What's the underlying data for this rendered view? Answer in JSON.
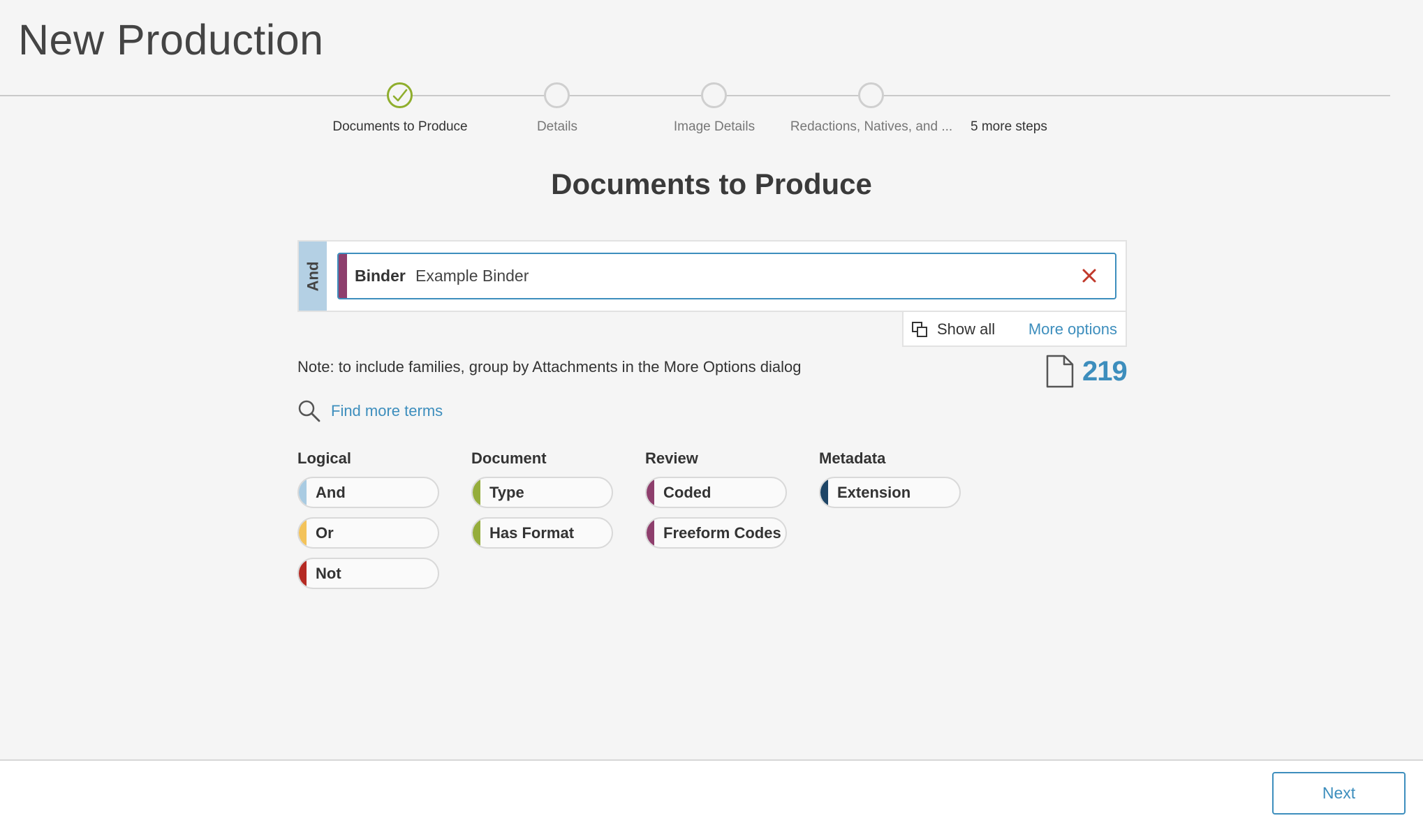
{
  "page": {
    "title": "New Production"
  },
  "stepper": {
    "steps": [
      {
        "label": "Documents to Produce",
        "state": "done",
        "icon": "check-icon"
      },
      {
        "label": "Details",
        "state": "pending"
      },
      {
        "label": "Image Details",
        "state": "pending"
      },
      {
        "label": "Redactions, Natives, and ...",
        "state": "pending"
      }
    ],
    "more_steps": "5 more steps"
  },
  "section": {
    "title": "Documents to Produce"
  },
  "query": {
    "operator": "And",
    "term": {
      "field": "Binder",
      "value": "Example Binder",
      "color": "#8e3f6d",
      "remove_icon": "close-icon"
    },
    "show_all": "Show all",
    "show_all_icon": "copy-icon",
    "more_options": "More options"
  },
  "note": "Note: to include families, group by Attachments in the More Options dialog",
  "doc_count": {
    "icon": "document-icon",
    "value": "219"
  },
  "find_more": {
    "icon": "search-icon",
    "label": "Find more terms"
  },
  "palette": {
    "columns": [
      {
        "title": "Logical",
        "items": [
          {
            "label": "And",
            "color": "#a9cbe2"
          },
          {
            "label": "Or",
            "color": "#f3c35a"
          },
          {
            "label": "Not",
            "color": "#b52a23"
          }
        ]
      },
      {
        "title": "Document",
        "items": [
          {
            "label": "Type",
            "color": "#95ad3b"
          },
          {
            "label": "Has Format",
            "color": "#95ad3b"
          }
        ]
      },
      {
        "title": "Review",
        "items": [
          {
            "label": "Coded",
            "color": "#8e3f6d"
          },
          {
            "label": "Freeform Codes",
            "color": "#8e3f6d"
          }
        ]
      },
      {
        "title": "Metadata",
        "items": [
          {
            "label": "Extension",
            "color": "#1e4566"
          }
        ]
      }
    ]
  },
  "footer": {
    "next_label": "Next"
  },
  "colors": {
    "accent": "#3d8ebd",
    "done": "#8fae2d",
    "remove": "#c0392b"
  }
}
